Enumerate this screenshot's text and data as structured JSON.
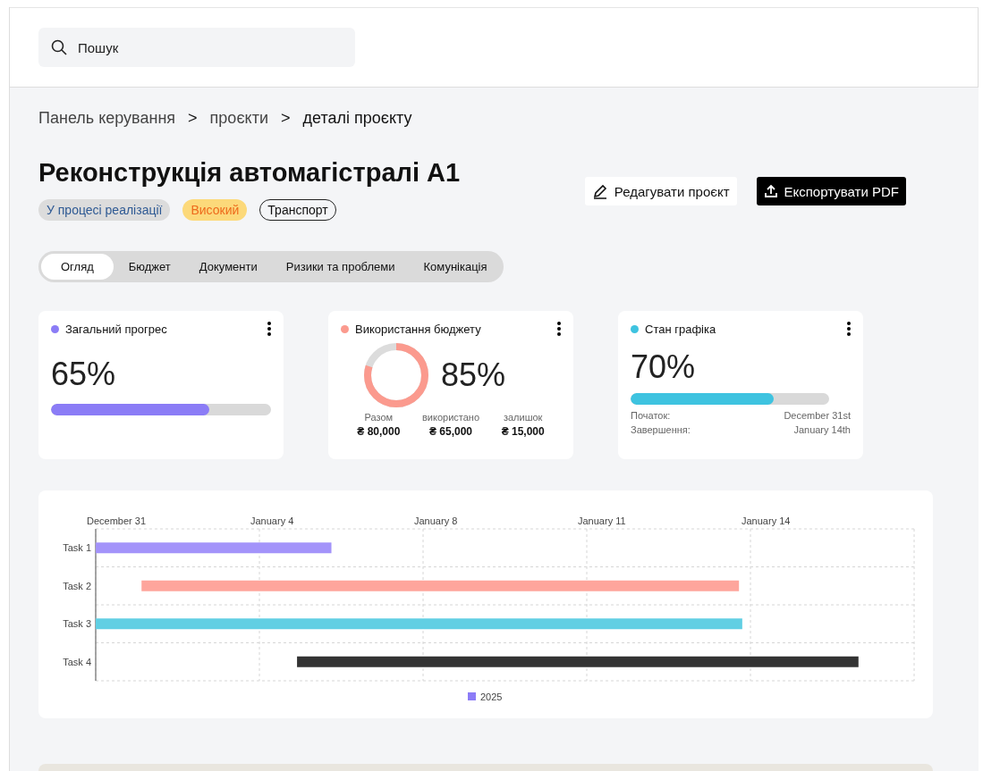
{
  "search": {
    "placeholder": "Пошук"
  },
  "breadcrumb": [
    {
      "label": "Панель керування",
      "current": false
    },
    {
      "label": "проєкти",
      "current": false
    },
    {
      "label": "деталі проєкту",
      "current": true
    }
  ],
  "breadcrumb_separator": ">",
  "title": "Реконструкція автомагістралі A1",
  "badges": [
    {
      "label": "У процесі реалізації",
      "kind": "status"
    },
    {
      "label": "Високий",
      "kind": "priority"
    },
    {
      "label": "Транспорт",
      "kind": "category"
    }
  ],
  "actions": [
    {
      "label": "Редагувати проєкт",
      "kind": "secondary"
    },
    {
      "label": "Експортувати PDF",
      "kind": "primary"
    }
  ],
  "tabs": [
    {
      "label": "Огляд",
      "selected": true
    },
    {
      "label": "Бюджет",
      "selected": false
    },
    {
      "label": "Документи",
      "selected": false
    },
    {
      "label": "Ризики та проблеми",
      "selected": false
    },
    {
      "label": "Комунікація",
      "selected": false
    }
  ],
  "cards": [
    {
      "kind": "bar",
      "title": "Загальний прогрес",
      "color": "#8b7cf6",
      "value": "65%",
      "level": 0.72
    },
    {
      "kind": "donut",
      "title": "Використання бюджету",
      "color": "#fb9a8e",
      "value": "85%",
      "level": 0.8,
      "stats": [
        {
          "label": "Разом",
          "value": "₴ 80,000"
        },
        {
          "label": "використано",
          "value": "₴ 65,000"
        },
        {
          "label": "залишок",
          "value": "₴ 15,000"
        }
      ]
    },
    {
      "kind": "schedule",
      "title": "Стан графіка",
      "color": "#3ec3e0",
      "value": "70%",
      "level": 0.72,
      "rows": [
        {
          "label": "Початок:",
          "value": "December 31st"
        },
        {
          "label": "Завершення:",
          "value": "January 14th"
        }
      ]
    }
  ],
  "gantt": {
    "date_labels": [
      "December 31",
      "January 4",
      "January 8",
      "January 11",
      "January 14"
    ],
    "tasks": [
      {
        "label": "Task 1",
        "color": "#a393fa"
      },
      {
        "label": "Task 2",
        "color": "#fea59c"
      },
      {
        "label": "Task 3",
        "color": "#61cfe3"
      },
      {
        "label": "Task 4",
        "color": "#333333"
      }
    ],
    "legend": {
      "label": "2025",
      "color": "#8c7cf7"
    }
  }
}
